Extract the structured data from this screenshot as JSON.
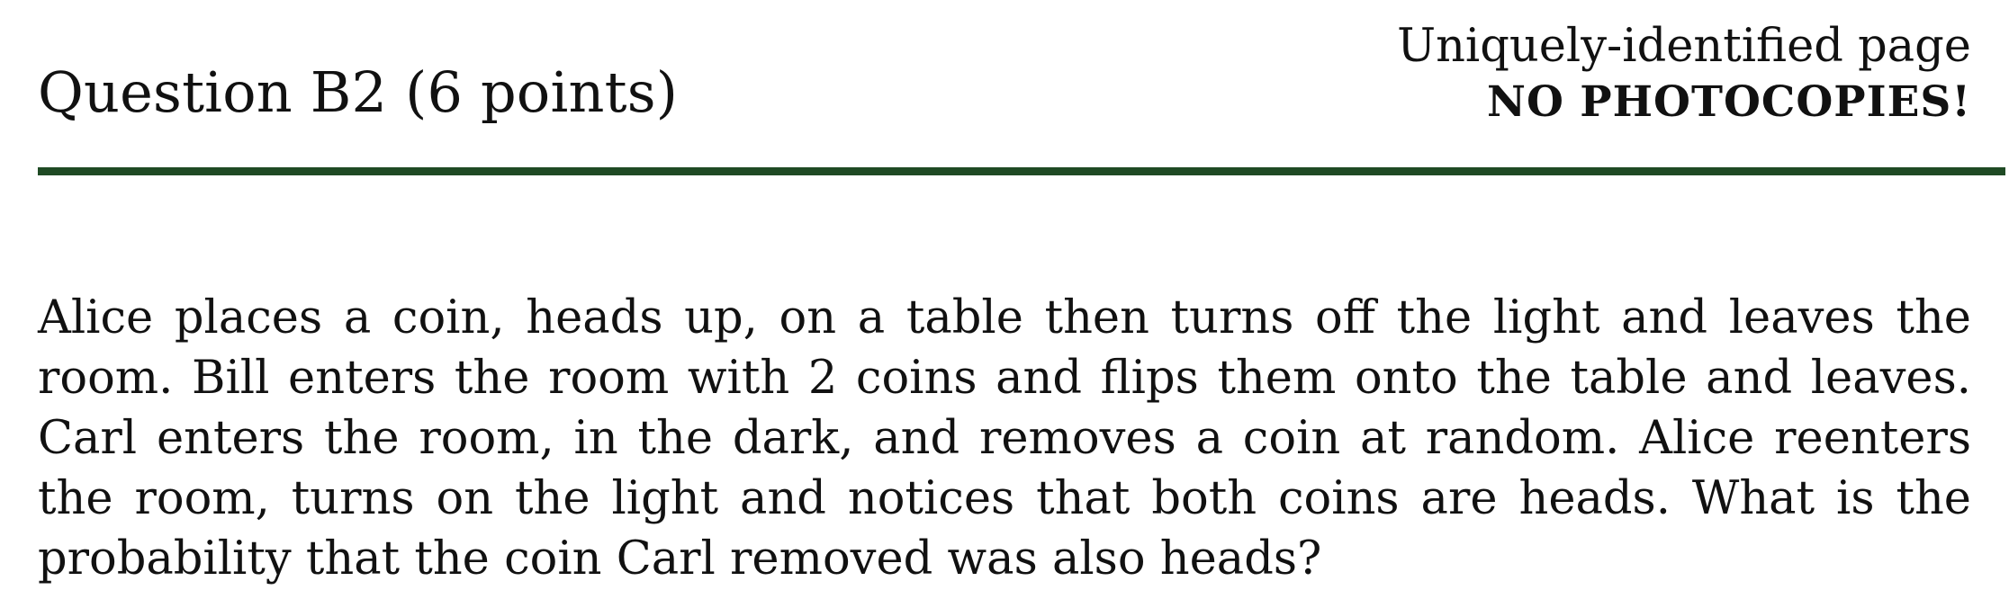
{
  "header": {
    "question_title": "Question B2 (6 points)",
    "notice_line1": "Uniquely-identified page",
    "notice_line2": "NO PHOTOCOPIES!",
    "rule_color": "#1f4a24"
  },
  "question": {
    "text": "Alice places a coin, heads up, on a table then turns off the light and leaves the room. Bill enters the room with 2 coins and flips them onto the table and leaves. Carl enters the room, in the dark, and removes a coin at random. Alice reenters the room, turns on the light and notices that both coins are heads. What is the probability that the coin Carl removed was also heads?"
  }
}
